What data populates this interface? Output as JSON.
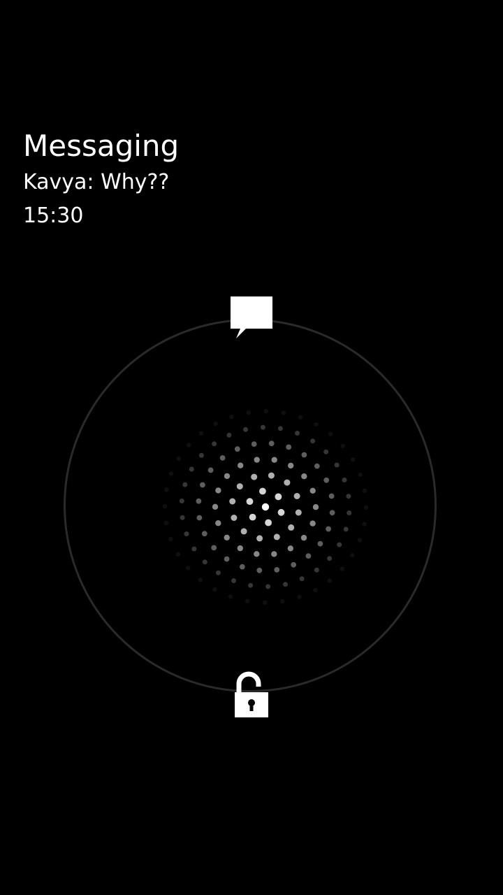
{
  "notification": {
    "app_name": "Messaging",
    "message": "Kavya: Why??",
    "time": "15:30"
  },
  "lockscreen": {
    "top_target_icon": "message-icon",
    "bottom_target_icon": "unlock-icon",
    "handle": "dot-grid-handle"
  },
  "colors": {
    "background": "#000000",
    "text": "#ffffff",
    "ring": "#2a2a2a"
  }
}
